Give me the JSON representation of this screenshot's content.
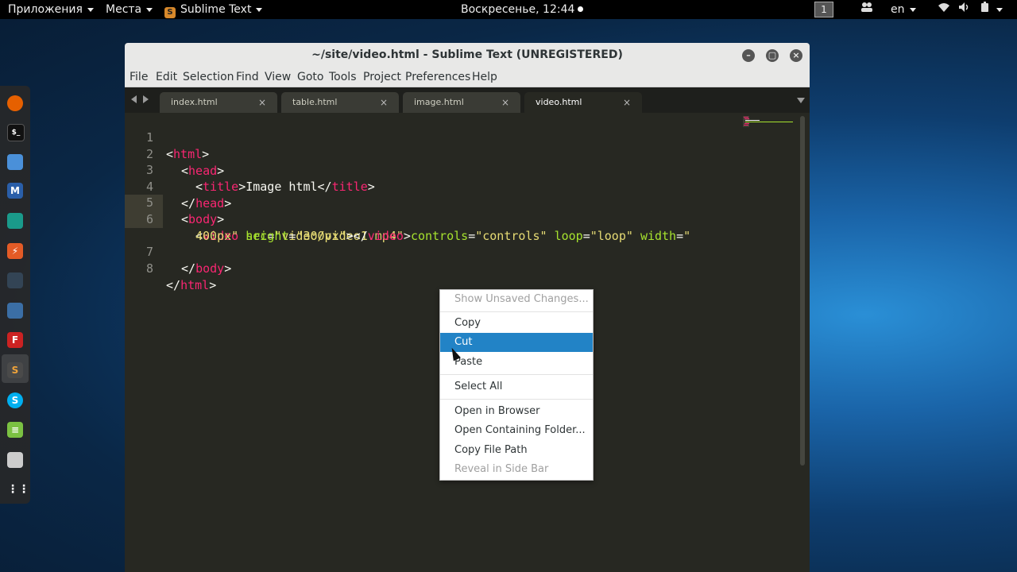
{
  "topbar": {
    "applications": "Приложения",
    "places": "Места",
    "app_name": "Sublime Text",
    "app_icon_letter": "S",
    "clock": "Воскресенье, 12:44",
    "workspace": "1",
    "language": "en"
  },
  "window": {
    "title": "~/site/video.html - Sublime Text (UNREGISTERED)",
    "menu": [
      "File",
      "Edit",
      "Selection",
      "Find",
      "View",
      "Goto",
      "Tools",
      "Project",
      "Preferences",
      "Help"
    ]
  },
  "tabs": [
    {
      "label": "index.html",
      "close": "×"
    },
    {
      "label": "table.html",
      "close": "×"
    },
    {
      "label": "image.html",
      "close": "×"
    },
    {
      "label": "video.html",
      "close": "×"
    }
  ],
  "editor": {
    "line_numbers": [
      "1",
      "2",
      "3",
      "4",
      "5",
      "6",
      "7",
      "8"
    ],
    "lines": {
      "l1": {
        "open": "<",
        "tag": "html",
        "close": ">"
      },
      "l2": {
        "open": "<",
        "tag": "head",
        "close": ">"
      },
      "l3": {
        "open": "<",
        "tag": "title",
        "mid": ">Image html</",
        "tag2": "title",
        "close": ">"
      },
      "l4": {
        "open": "</",
        "tag": "head",
        "close": ">"
      },
      "l5": {
        "open": "<",
        "tag": "body",
        "close": ">"
      },
      "l6a": {
        "open": "<",
        "tag": "video",
        "a1": "src",
        "v1": "\"video/video1.mp4\"",
        "a2": "controls",
        "v2": "\"controls\"",
        "a3": "loop",
        "v3": "\"loop\"",
        "a4": "width",
        "v4": "\""
      },
      "l6b": {
        "v4": "400px\"",
        "a5": "height",
        "v5": "\"300px\"",
        "mid": "></",
        "tag": "video",
        "close": ">"
      },
      "l7": {
        "open": "</",
        "tag": "body",
        "close": ">"
      },
      "l8": {
        "open": "</",
        "tag": "html",
        "close": ">"
      },
      "eq": "="
    }
  },
  "context_menu": {
    "show_unsaved": "Show Unsaved Changes...",
    "copy": "Copy",
    "cut": "Cut",
    "paste": "Paste",
    "select_all": "Select All",
    "open_browser": "Open in Browser",
    "open_folder": "Open Containing Folder...",
    "copy_path": "Copy File Path",
    "reveal_sidebar": "Reveal in Side Bar"
  },
  "dock": {
    "items": [
      "firefox-icon",
      "terminal-icon",
      "files-icon",
      "metasploit-icon",
      "armitage-icon",
      "burpsuite-icon",
      "maltego-icon",
      "beef-icon",
      "faraday-icon",
      "sublime-text-icon",
      "skype-icon",
      "notes-icon",
      "screenshot-icon",
      "show-apps-icon"
    ]
  },
  "colors": {
    "editor_bg": "#272822",
    "tag": "#f92672",
    "attr": "#a6e22e",
    "string": "#e6db74",
    "menu_highlight": "#2283c6"
  }
}
